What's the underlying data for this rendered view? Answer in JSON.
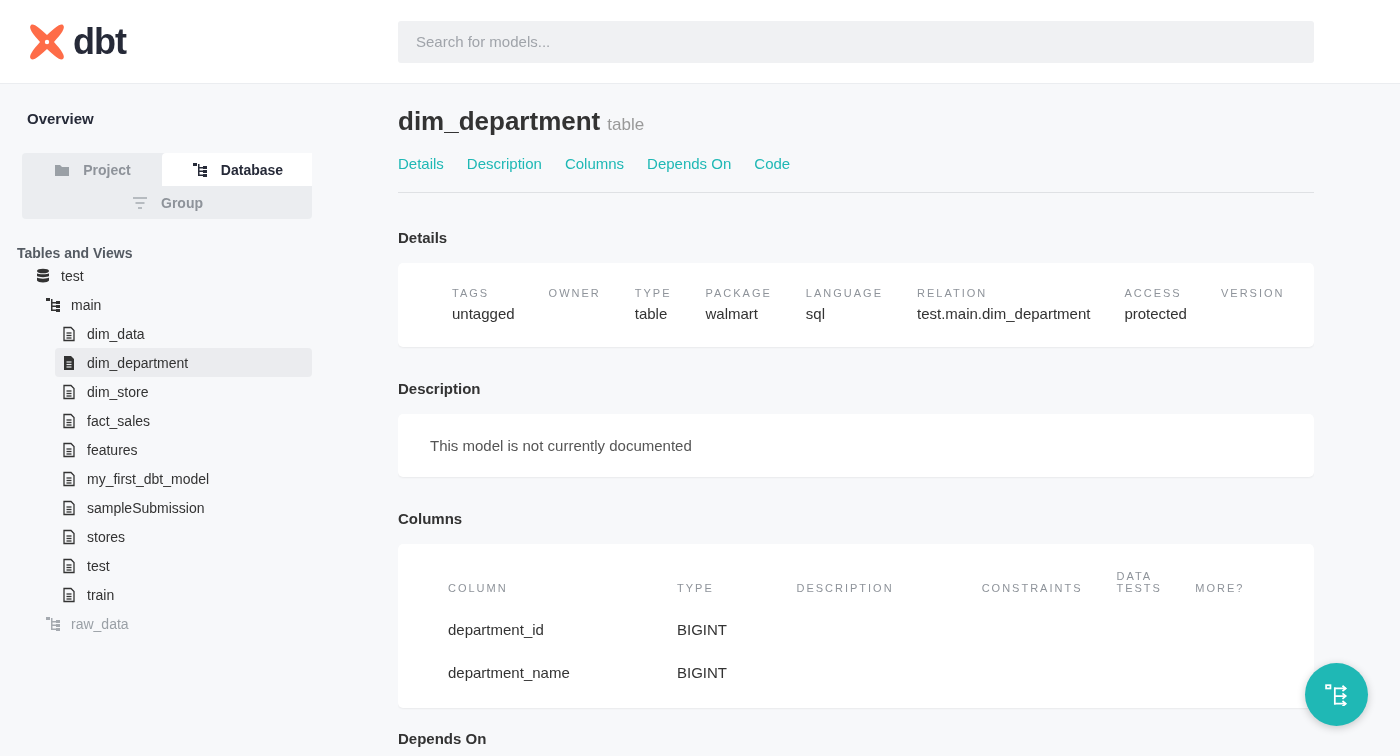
{
  "header": {
    "logo_text": "dbt",
    "search": {
      "placeholder": "Search for models..."
    }
  },
  "sidebar": {
    "overview": "Overview",
    "tabs": [
      {
        "label": "Project",
        "kind": "folder",
        "selected": false
      },
      {
        "label": "Database",
        "kind": "schema",
        "selected": true
      },
      {
        "label": "Group",
        "kind": "filter",
        "selected": false
      }
    ],
    "section_title": "Tables and Views",
    "tree": [
      {
        "label": "test",
        "kind": "database",
        "expanded": true,
        "children": [
          {
            "label": "main",
            "kind": "schema",
            "expanded": true,
            "children": [
              {
                "label": "dim_data",
                "kind": "model",
                "selected": false
              },
              {
                "label": "dim_department",
                "kind": "model",
                "selected": true
              },
              {
                "label": "dim_store",
                "kind": "model",
                "selected": false
              },
              {
                "label": "fact_sales",
                "kind": "model",
                "selected": false
              },
              {
                "label": "features",
                "kind": "model",
                "selected": false
              },
              {
                "label": "my_first_dbt_model",
                "kind": "model",
                "selected": false
              },
              {
                "label": "sampleSubmission",
                "kind": "model",
                "selected": false
              },
              {
                "label": "stores",
                "kind": "model",
                "selected": false
              },
              {
                "label": "test",
                "kind": "model",
                "selected": false
              },
              {
                "label": "train",
                "kind": "model",
                "selected": false
              }
            ]
          },
          {
            "label": "raw_data",
            "kind": "schema",
            "expanded": false
          }
        ]
      }
    ]
  },
  "model": {
    "name": "dim_department",
    "type": "table",
    "nav": [
      "Details",
      "Description",
      "Columns",
      "Depends On",
      "Code"
    ],
    "details": {
      "title": "Details",
      "fields": [
        {
          "label": "TAGS",
          "value": "untagged"
        },
        {
          "label": "OWNER"
        },
        {
          "label": "TYPE",
          "value": "table"
        },
        {
          "label": "PACKAGE",
          "value": "walmart"
        },
        {
          "label": "LANGUAGE",
          "value": "sql"
        },
        {
          "label": "RELATION",
          "value": "test.main.dim_department"
        },
        {
          "label": "ACCESS",
          "value": "protected"
        },
        {
          "label": "VERSION"
        }
      ]
    },
    "description": {
      "title": "Description",
      "text": "This model is not currently documented"
    },
    "columns": {
      "title": "Columns",
      "headers": [
        "COLUMN",
        "TYPE",
        "DESCRIPTION",
        "CONSTRAINTS",
        "DATA TESTS",
        "MORE?"
      ],
      "rows": [
        [
          "department_id",
          "BIGINT"
        ],
        [
          "department_name",
          "BIGINT"
        ]
      ]
    },
    "depends_on": {
      "title": "Depends On"
    }
  }
}
